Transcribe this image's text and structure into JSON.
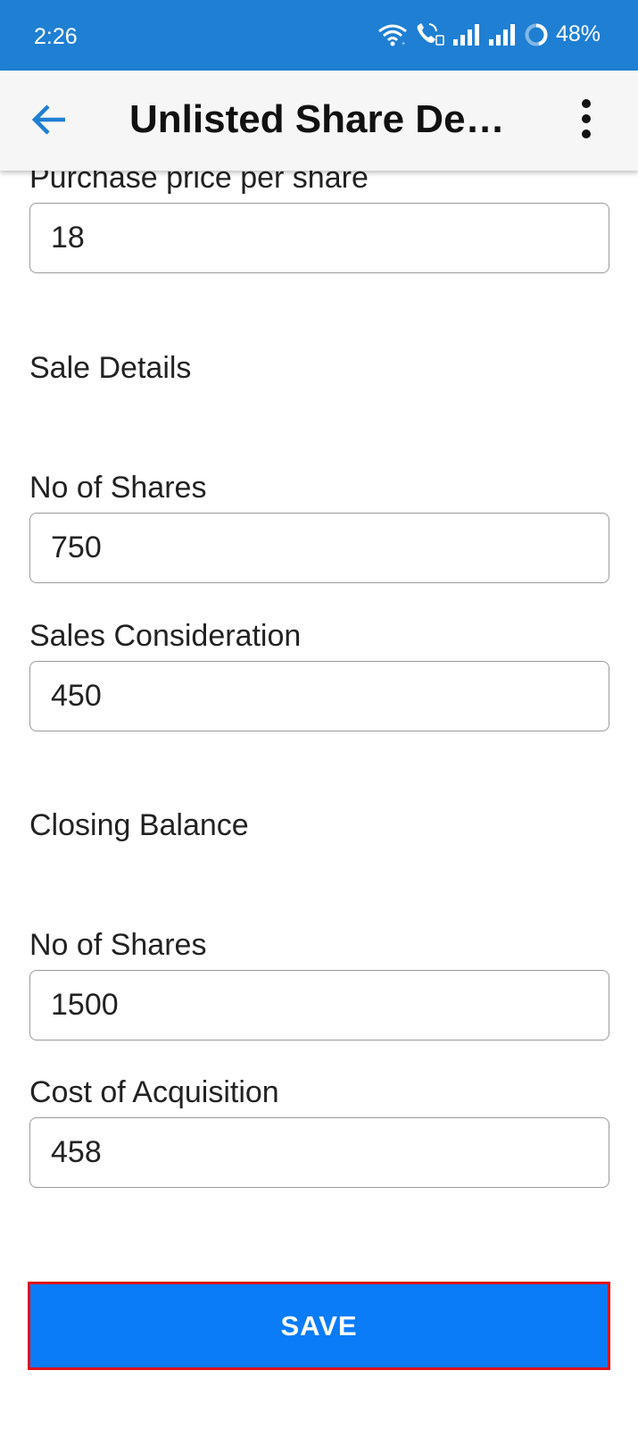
{
  "status_bar": {
    "time": "2:26",
    "battery_percent": "48%",
    "icons": [
      "wifi-icon",
      "wifi-calling-icon",
      "signal-bars-icon",
      "signal-bars-icon",
      "battery-ring-icon"
    ]
  },
  "app_bar": {
    "title": "Unlisted Share Details",
    "back_icon": "arrow-left-icon",
    "menu_icon": "more-vertical-icon",
    "accent_color": "#1f7fd3"
  },
  "form": {
    "purchase_price": {
      "label": "Purchase price per share",
      "value": "18"
    },
    "sale_details": {
      "heading": "Sale Details",
      "no_of_shares": {
        "label": "No of Shares",
        "value": "750"
      },
      "sales_consideration": {
        "label": "Sales Consideration",
        "value": "450"
      }
    },
    "closing_balance": {
      "heading": "Closing Balance",
      "no_of_shares": {
        "label": "No of Shares",
        "value": "1500"
      },
      "cost_of_acquisition": {
        "label": "Cost of Acquisition",
        "value": "458"
      }
    }
  },
  "actions": {
    "save_label": "SAVE",
    "save_color": "#0a7cf8",
    "save_highlight_color": "#e0121b"
  }
}
